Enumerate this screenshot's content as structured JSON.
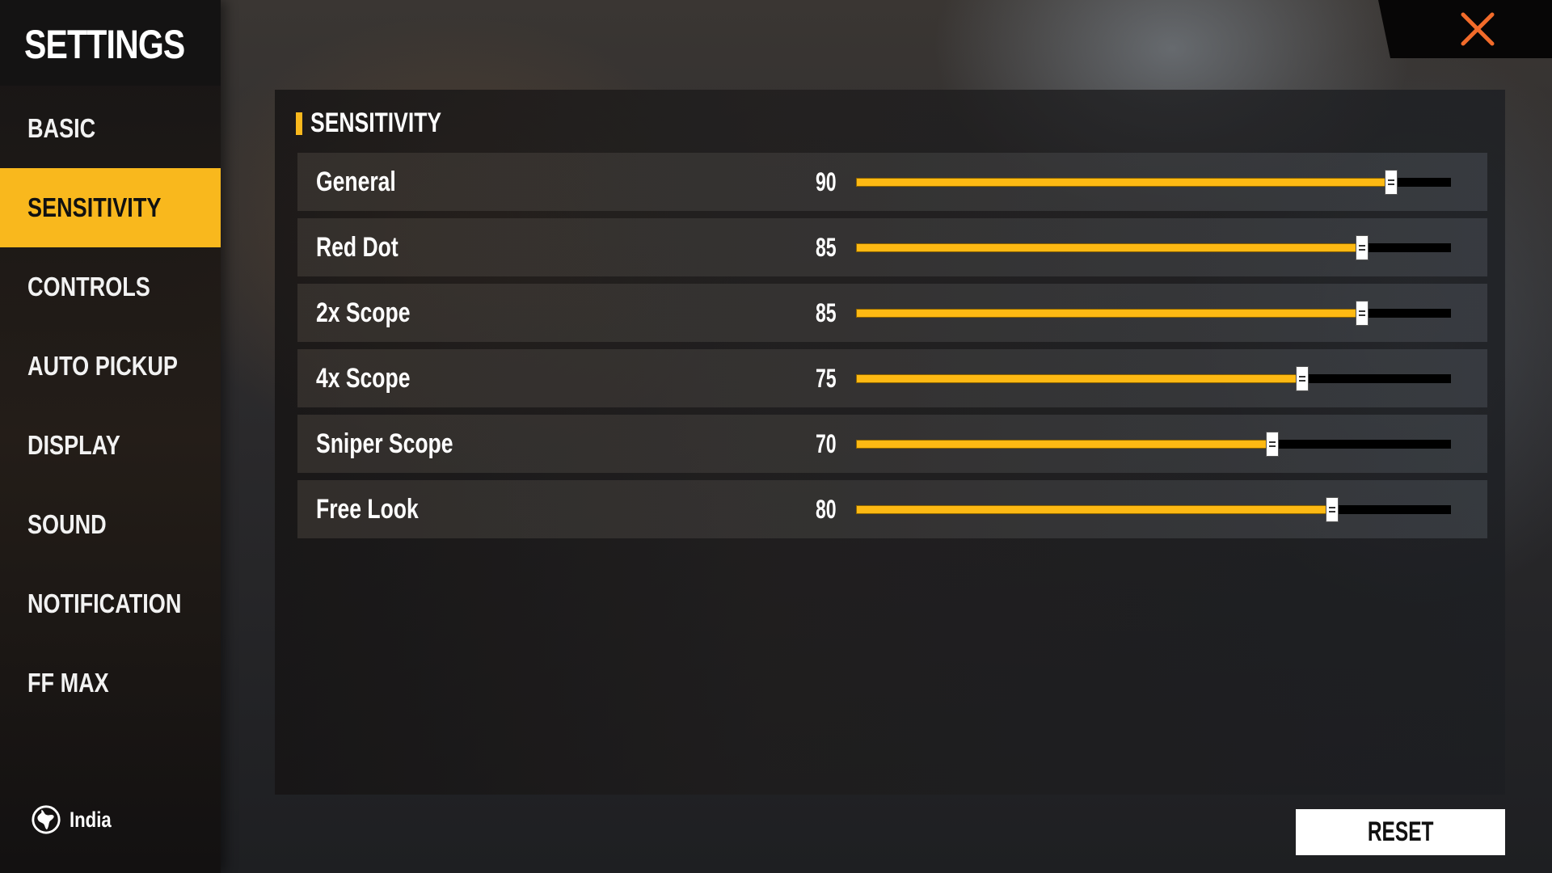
{
  "sidebar": {
    "title": "SETTINGS",
    "items": [
      {
        "label": "BASIC",
        "active": false
      },
      {
        "label": "SENSITIVITY",
        "active": true
      },
      {
        "label": "CONTROLS",
        "active": false
      },
      {
        "label": "AUTO PICKUP",
        "active": false
      },
      {
        "label": "DISPLAY",
        "active": false
      },
      {
        "label": "SOUND",
        "active": false
      },
      {
        "label": "NOTIFICATION",
        "active": false
      },
      {
        "label": "FF MAX",
        "active": false
      }
    ],
    "region": {
      "icon": "globe-icon",
      "label": "India"
    }
  },
  "close": {
    "icon": "close-icon",
    "color": "#f26b2a"
  },
  "panel": {
    "section_title": "SENSITIVITY",
    "accent": "#f9b81d",
    "sliders": [
      {
        "label": "General",
        "value": 90,
        "max": 100
      },
      {
        "label": "Red Dot",
        "value": 85,
        "max": 100
      },
      {
        "label": "2x Scope",
        "value": 85,
        "max": 100
      },
      {
        "label": "4x Scope",
        "value": 75,
        "max": 100
      },
      {
        "label": "Sniper Scope",
        "value": 70,
        "max": 100
      },
      {
        "label": "Free Look",
        "value": 80,
        "max": 100
      }
    ]
  },
  "footer": {
    "reset_label": "RESET"
  }
}
